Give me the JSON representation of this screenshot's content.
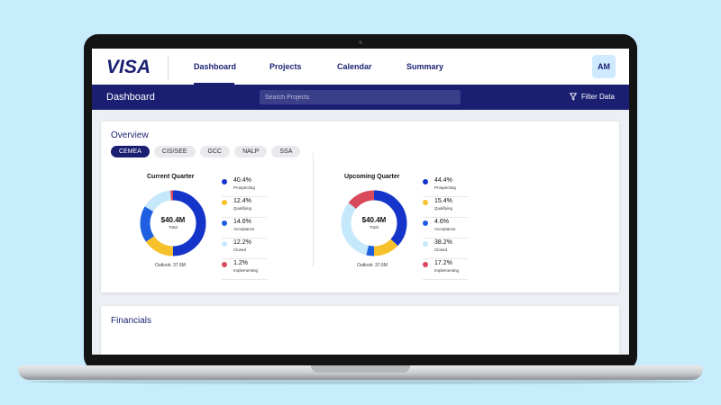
{
  "app": {
    "brand": "VISA",
    "nav": [
      "Dashboard",
      "Projects",
      "Calendar",
      "Summary"
    ],
    "user_initials": "AM"
  },
  "subheader": {
    "title": "Dashboard",
    "search_placeholder": "Search Projects",
    "filter_label": "Filter Data"
  },
  "overview": {
    "title": "Overview",
    "regions": [
      "CEMEA",
      "CIS/SEE",
      "GCC",
      "NALP",
      "SSA"
    ],
    "selected_region": "CEMEA"
  },
  "current": {
    "title": "Current Quarter",
    "total_value": "$40.4M",
    "total_label": "Total",
    "outlook": "Outlook: 37.6M",
    "segments": [
      {
        "pct": "40.4%",
        "value": 40.4,
        "label": "Prospecting",
        "color": "#1534c9"
      },
      {
        "pct": "12.4%",
        "value": 12.4,
        "label": "Qualifying",
        "color": "#f6c12b"
      },
      {
        "pct": "14.6%",
        "value": 14.6,
        "label": "Acceptance",
        "color": "#1d5fe0"
      },
      {
        "pct": "12.2%",
        "value": 12.2,
        "label": "Closed",
        "color": "#c6e8fb"
      },
      {
        "pct": "1.2%",
        "value": 1.2,
        "label": "Implementing",
        "color": "#d84a5b"
      }
    ]
  },
  "upcoming": {
    "title": "Upcoming Quarter",
    "total_value": "$40.4M",
    "total_label": "Total",
    "outlook": "Outlook: 37.6M",
    "segments": [
      {
        "pct": "44.4%",
        "value": 44.4,
        "label": "Prospecting",
        "color": "#1534c9"
      },
      {
        "pct": "15.4%",
        "value": 15.4,
        "label": "Qualifying",
        "color": "#f6c12b"
      },
      {
        "pct": "4.6%",
        "value": 4.6,
        "label": "Acceptance",
        "color": "#1d5fe0"
      },
      {
        "pct": "38.2%",
        "value": 38.2,
        "label": "Closed",
        "color": "#c6e8fb"
      },
      {
        "pct": "17.2%",
        "value": 17.2,
        "label": "Implementing",
        "color": "#d84a5b"
      }
    ]
  },
  "financials": {
    "title": "Financials"
  }
}
